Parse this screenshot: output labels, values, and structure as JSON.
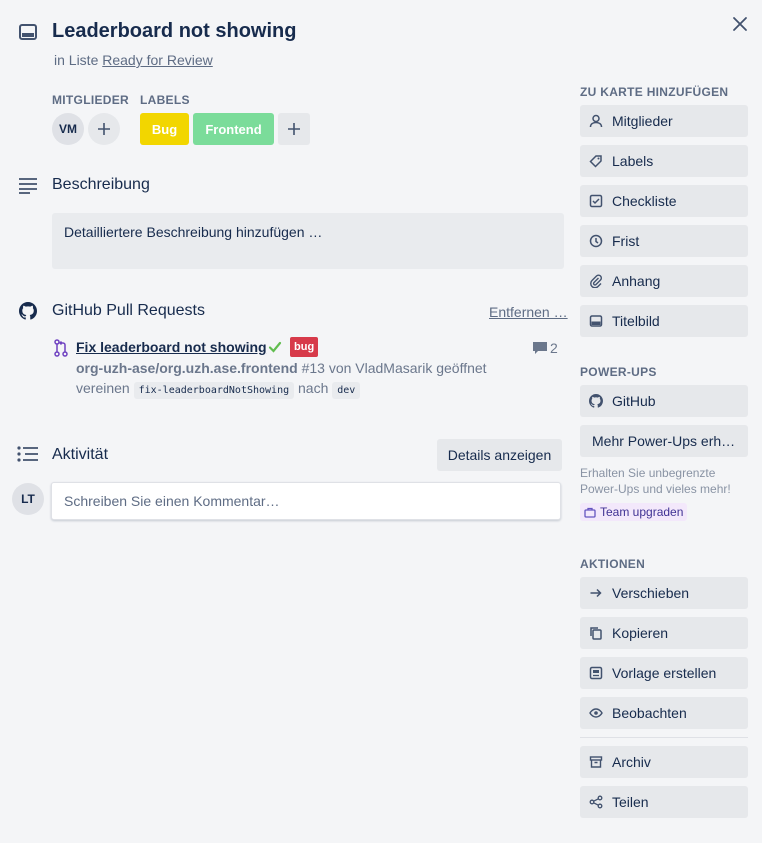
{
  "card": {
    "title": "Leaderboard not showing",
    "list_prefix": "in Liste",
    "list_name": "Ready for Review"
  },
  "members": {
    "heading": "MITGLIEDER",
    "avatar_initials": "VM"
  },
  "labels": {
    "heading": "LABELS",
    "items": [
      {
        "text": "Bug",
        "color": "#f2d600"
      },
      {
        "text": "Frontend",
        "color": "#7bdc9a"
      }
    ]
  },
  "description": {
    "heading": "Beschreibung",
    "placeholder": "Detailliertere Beschreibung hinzufügen …"
  },
  "github": {
    "heading": "GitHub Pull Requests",
    "remove_label": "Entfernen …",
    "pr": {
      "title": "Fix leaderboard not showing",
      "badge": "bug",
      "badge_color": "#d73a4a",
      "comment_count": "2",
      "repo": "org-uzh-ase/org.uzh.ase.frontend",
      "details": "#13 von VladMasarik geöffnet",
      "merge_prefix": "vereinen",
      "source_branch": "fix-leaderboardNotShowing",
      "merge_middle": "nach",
      "target_branch": "dev"
    }
  },
  "activity": {
    "heading": "Aktivität",
    "details_button": "Details anzeigen",
    "user_initials": "LT",
    "comment_placeholder": "Schreiben Sie einen Kommentar…"
  },
  "sidebar": {
    "add_heading": "ZU KARTE HINZUFÜGEN",
    "add_items": [
      {
        "label": "Mitglieder",
        "icon": "person-icon"
      },
      {
        "label": "Labels",
        "icon": "tag-icon"
      },
      {
        "label": "Checkliste",
        "icon": "checkbox-icon"
      },
      {
        "label": "Frist",
        "icon": "clock-icon"
      },
      {
        "label": "Anhang",
        "icon": "paperclip-icon"
      },
      {
        "label": "Titelbild",
        "icon": "card-cover-icon"
      }
    ],
    "powerups_heading": "POWER-UPS",
    "powerups": [
      {
        "label": "GitHub",
        "icon": "github-icon"
      }
    ],
    "more_powerups": "Mehr Power-Ups erh…",
    "upgrade_note": "Erhalten Sie unbegrenzte Power-Ups und vieles mehr!",
    "upgrade_button": "Team upgraden",
    "actions_heading": "AKTIONEN",
    "actions": [
      {
        "label": "Verschieben",
        "icon": "arrow-right-icon"
      },
      {
        "label": "Kopieren",
        "icon": "copy-icon"
      },
      {
        "label": "Vorlage erstellen",
        "icon": "template-icon"
      },
      {
        "label": "Beobachten",
        "icon": "eye-icon"
      }
    ],
    "archive_actions": [
      {
        "label": "Archiv",
        "icon": "archive-icon"
      },
      {
        "label": "Teilen",
        "icon": "share-icon"
      }
    ]
  },
  "colors": {
    "background": "#f4f5f7",
    "button": "#e6e8eb",
    "text": "#172b4d",
    "muted": "#5e6c84",
    "check": "#61bd4f"
  }
}
